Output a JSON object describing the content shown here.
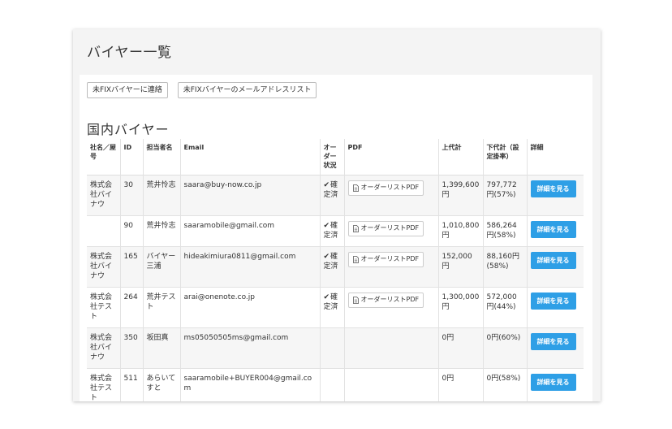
{
  "page": {
    "title": "バイヤー一覧"
  },
  "toolbar": {
    "contact_unfixed": "未FIXバイヤーに連絡",
    "mail_list_unfixed": "未FIXバイヤーのメールアドレスリスト"
  },
  "section": {
    "title": "国内バイヤー"
  },
  "table": {
    "headers": {
      "company": "社名／屋号",
      "id": "ID",
      "person": "担当者名",
      "email": "Email",
      "order_status": "オーダー状況",
      "pdf": "PDF",
      "upper_price": "上代計",
      "lower_price": "下代計（設定掛率）",
      "detail": "詳細"
    },
    "pdf_label": "オーダーリストPDF",
    "detail_label": "詳細を見る",
    "check_icon": "checkmark-icon",
    "pdf_icon": "document-icon",
    "accent_color": "#2e9fe6",
    "rows": [
      {
        "company": "株式会社バイナウ",
        "id": "30",
        "person": "荒井怜志",
        "email": "saara@buy-now.co.jp",
        "status": "確定済",
        "has_pdf": true,
        "upper": "1,399,600円",
        "lower": "797,772円(57%)"
      },
      {
        "company": "",
        "id": "90",
        "person": "荒井怜志",
        "email": "saaramobile@gmail.com",
        "status": "確定済",
        "has_pdf": true,
        "upper": "1,010,800円",
        "lower": "586,264円(58%)"
      },
      {
        "company": "株式会社バイナウ",
        "id": "165",
        "person": "バイヤー三浦",
        "email": "hideakimiura0811@gmail.com",
        "status": "確定済",
        "has_pdf": true,
        "upper": "152,000円",
        "lower": "88,160円(58%)"
      },
      {
        "company": "株式会社テスト",
        "id": "264",
        "person": "荒井テスト",
        "email": "arai@onenote.co.jp",
        "status": "確定済",
        "has_pdf": true,
        "upper": "1,300,000円",
        "lower": "572,000円(44%)"
      },
      {
        "company": "株式会社バイナウ",
        "id": "350",
        "person": "坂田真",
        "email": "ms05050505ms@gmail.com",
        "status": "",
        "has_pdf": false,
        "upper": "0円",
        "lower": "0円(60%)"
      },
      {
        "company": "株式会社テスト",
        "id": "511",
        "person": "あらいてすと",
        "email": "saaramobile+BUYER004@gmail.com",
        "status": "",
        "has_pdf": false,
        "upper": "0円",
        "lower": "0円(58%)"
      }
    ]
  }
}
